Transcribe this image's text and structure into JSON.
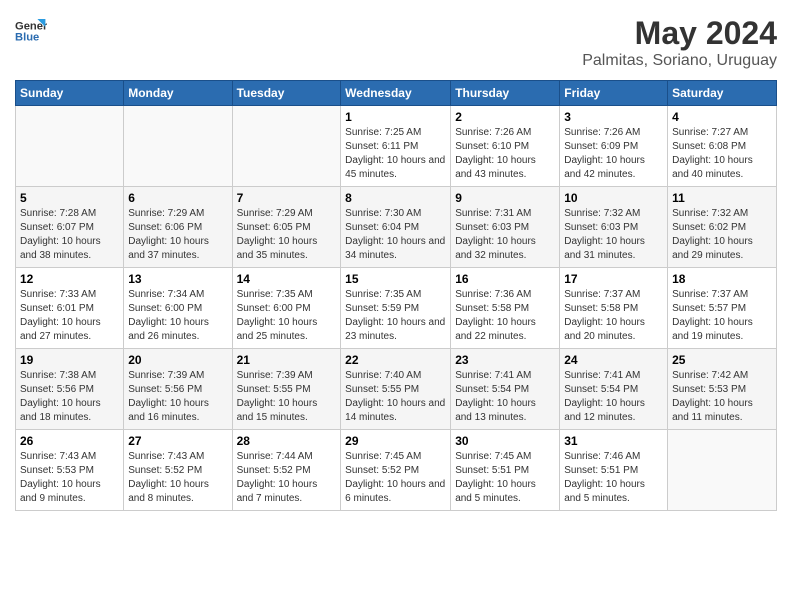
{
  "logo": {
    "line1": "General",
    "line2": "Blue"
  },
  "title": "May 2024",
  "subtitle": "Palmitas, Soriano, Uruguay",
  "days_header": [
    "Sunday",
    "Monday",
    "Tuesday",
    "Wednesday",
    "Thursday",
    "Friday",
    "Saturday"
  ],
  "weeks": [
    [
      {
        "num": "",
        "sunrise": "",
        "sunset": "",
        "daylight": ""
      },
      {
        "num": "",
        "sunrise": "",
        "sunset": "",
        "daylight": ""
      },
      {
        "num": "",
        "sunrise": "",
        "sunset": "",
        "daylight": ""
      },
      {
        "num": "1",
        "sunrise": "Sunrise: 7:25 AM",
        "sunset": "Sunset: 6:11 PM",
        "daylight": "Daylight: 10 hours and 45 minutes."
      },
      {
        "num": "2",
        "sunrise": "Sunrise: 7:26 AM",
        "sunset": "Sunset: 6:10 PM",
        "daylight": "Daylight: 10 hours and 43 minutes."
      },
      {
        "num": "3",
        "sunrise": "Sunrise: 7:26 AM",
        "sunset": "Sunset: 6:09 PM",
        "daylight": "Daylight: 10 hours and 42 minutes."
      },
      {
        "num": "4",
        "sunrise": "Sunrise: 7:27 AM",
        "sunset": "Sunset: 6:08 PM",
        "daylight": "Daylight: 10 hours and 40 minutes."
      }
    ],
    [
      {
        "num": "5",
        "sunrise": "Sunrise: 7:28 AM",
        "sunset": "Sunset: 6:07 PM",
        "daylight": "Daylight: 10 hours and 38 minutes."
      },
      {
        "num": "6",
        "sunrise": "Sunrise: 7:29 AM",
        "sunset": "Sunset: 6:06 PM",
        "daylight": "Daylight: 10 hours and 37 minutes."
      },
      {
        "num": "7",
        "sunrise": "Sunrise: 7:29 AM",
        "sunset": "Sunset: 6:05 PM",
        "daylight": "Daylight: 10 hours and 35 minutes."
      },
      {
        "num": "8",
        "sunrise": "Sunrise: 7:30 AM",
        "sunset": "Sunset: 6:04 PM",
        "daylight": "Daylight: 10 hours and 34 minutes."
      },
      {
        "num": "9",
        "sunrise": "Sunrise: 7:31 AM",
        "sunset": "Sunset: 6:03 PM",
        "daylight": "Daylight: 10 hours and 32 minutes."
      },
      {
        "num": "10",
        "sunrise": "Sunrise: 7:32 AM",
        "sunset": "Sunset: 6:03 PM",
        "daylight": "Daylight: 10 hours and 31 minutes."
      },
      {
        "num": "11",
        "sunrise": "Sunrise: 7:32 AM",
        "sunset": "Sunset: 6:02 PM",
        "daylight": "Daylight: 10 hours and 29 minutes."
      }
    ],
    [
      {
        "num": "12",
        "sunrise": "Sunrise: 7:33 AM",
        "sunset": "Sunset: 6:01 PM",
        "daylight": "Daylight: 10 hours and 27 minutes."
      },
      {
        "num": "13",
        "sunrise": "Sunrise: 7:34 AM",
        "sunset": "Sunset: 6:00 PM",
        "daylight": "Daylight: 10 hours and 26 minutes."
      },
      {
        "num": "14",
        "sunrise": "Sunrise: 7:35 AM",
        "sunset": "Sunset: 6:00 PM",
        "daylight": "Daylight: 10 hours and 25 minutes."
      },
      {
        "num": "15",
        "sunrise": "Sunrise: 7:35 AM",
        "sunset": "Sunset: 5:59 PM",
        "daylight": "Daylight: 10 hours and 23 minutes."
      },
      {
        "num": "16",
        "sunrise": "Sunrise: 7:36 AM",
        "sunset": "Sunset: 5:58 PM",
        "daylight": "Daylight: 10 hours and 22 minutes."
      },
      {
        "num": "17",
        "sunrise": "Sunrise: 7:37 AM",
        "sunset": "Sunset: 5:58 PM",
        "daylight": "Daylight: 10 hours and 20 minutes."
      },
      {
        "num": "18",
        "sunrise": "Sunrise: 7:37 AM",
        "sunset": "Sunset: 5:57 PM",
        "daylight": "Daylight: 10 hours and 19 minutes."
      }
    ],
    [
      {
        "num": "19",
        "sunrise": "Sunrise: 7:38 AM",
        "sunset": "Sunset: 5:56 PM",
        "daylight": "Daylight: 10 hours and 18 minutes."
      },
      {
        "num": "20",
        "sunrise": "Sunrise: 7:39 AM",
        "sunset": "Sunset: 5:56 PM",
        "daylight": "Daylight: 10 hours and 16 minutes."
      },
      {
        "num": "21",
        "sunrise": "Sunrise: 7:39 AM",
        "sunset": "Sunset: 5:55 PM",
        "daylight": "Daylight: 10 hours and 15 minutes."
      },
      {
        "num": "22",
        "sunrise": "Sunrise: 7:40 AM",
        "sunset": "Sunset: 5:55 PM",
        "daylight": "Daylight: 10 hours and 14 minutes."
      },
      {
        "num": "23",
        "sunrise": "Sunrise: 7:41 AM",
        "sunset": "Sunset: 5:54 PM",
        "daylight": "Daylight: 10 hours and 13 minutes."
      },
      {
        "num": "24",
        "sunrise": "Sunrise: 7:41 AM",
        "sunset": "Sunset: 5:54 PM",
        "daylight": "Daylight: 10 hours and 12 minutes."
      },
      {
        "num": "25",
        "sunrise": "Sunrise: 7:42 AM",
        "sunset": "Sunset: 5:53 PM",
        "daylight": "Daylight: 10 hours and 11 minutes."
      }
    ],
    [
      {
        "num": "26",
        "sunrise": "Sunrise: 7:43 AM",
        "sunset": "Sunset: 5:53 PM",
        "daylight": "Daylight: 10 hours and 9 minutes."
      },
      {
        "num": "27",
        "sunrise": "Sunrise: 7:43 AM",
        "sunset": "Sunset: 5:52 PM",
        "daylight": "Daylight: 10 hours and 8 minutes."
      },
      {
        "num": "28",
        "sunrise": "Sunrise: 7:44 AM",
        "sunset": "Sunset: 5:52 PM",
        "daylight": "Daylight: 10 hours and 7 minutes."
      },
      {
        "num": "29",
        "sunrise": "Sunrise: 7:45 AM",
        "sunset": "Sunset: 5:52 PM",
        "daylight": "Daylight: 10 hours and 6 minutes."
      },
      {
        "num": "30",
        "sunrise": "Sunrise: 7:45 AM",
        "sunset": "Sunset: 5:51 PM",
        "daylight": "Daylight: 10 hours and 5 minutes."
      },
      {
        "num": "31",
        "sunrise": "Sunrise: 7:46 AM",
        "sunset": "Sunset: 5:51 PM",
        "daylight": "Daylight: 10 hours and 5 minutes."
      },
      {
        "num": "",
        "sunrise": "",
        "sunset": "",
        "daylight": ""
      }
    ]
  ]
}
